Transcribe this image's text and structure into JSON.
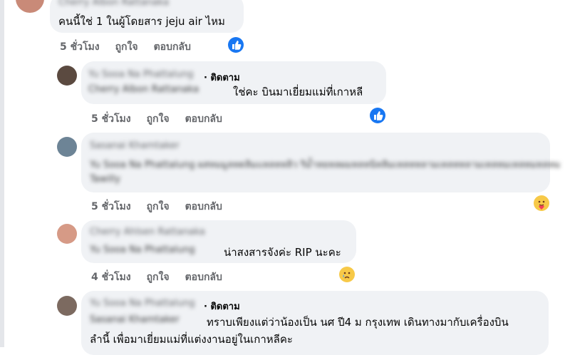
{
  "comments": [
    {
      "text": "คนนี้ใช่ 1 ในผู้โดยสาร jeju air ไหม",
      "time": "5 ชั่วโมง",
      "like": "ถูกใจ",
      "reply": "ตอบกลับ",
      "reaction": "like-icon"
    },
    {
      "follow": "· ติดตาม",
      "text": "ใช่คะ บินมาเยี่ยมแม่ที่เกาหลี",
      "time": "5 ชั่วโมง",
      "like": "ถูกใจ",
      "reply": "ตอบกลับ",
      "reaction": "like-icon"
    },
    {
      "time": "5 ชั่วโมง",
      "like": "ถูกใจ",
      "reply": "ตอบกลับ",
      "reaction": "care-emoji-icon"
    },
    {
      "text": "น่าสงสารจังค่ะ RIP นะคะ",
      "time": "4 ชั่วโมง",
      "like": "ถูกใจ",
      "reply": "ตอบกลับ",
      "reaction": "sad-emoji-icon"
    },
    {
      "follow": "· ติดตาม",
      "text_line1": "ทราบเพียงแต่ว่าน้องเป็น นศ ปี4 ม กรุงเทพ เดินทางมากับเครื่องบิน",
      "text_line2": "ลำนี้ เพื่อมาเยี่ยมแม่ที่แต่งงานอยู่ในเกาหลีคะ"
    }
  ],
  "colors": {
    "bubble": "#f0f2f5",
    "like_blue": "#1877f2",
    "meta_gray": "#65676b"
  }
}
